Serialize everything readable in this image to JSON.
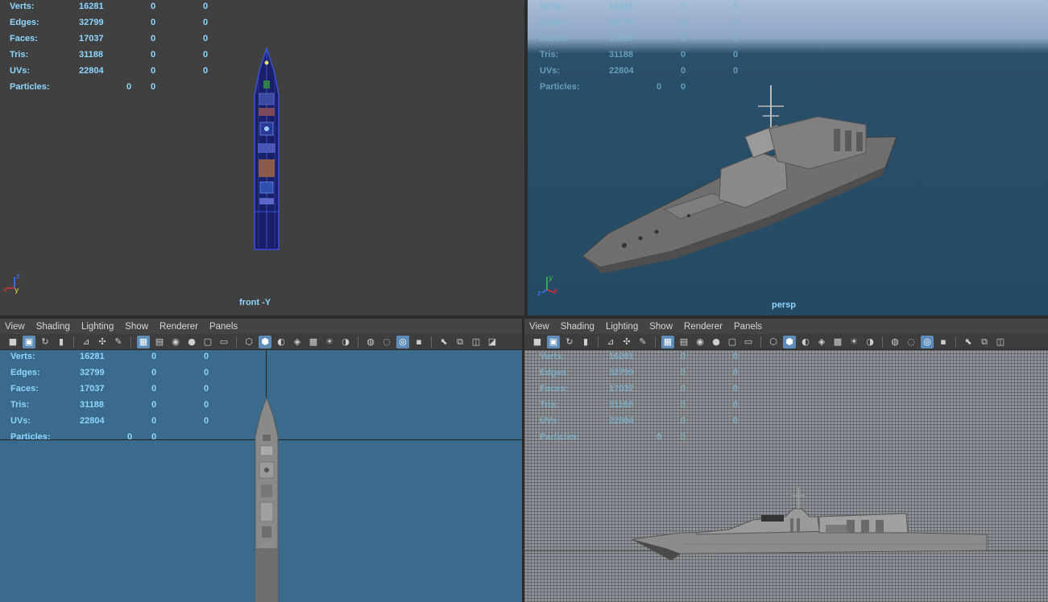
{
  "stats": [
    {
      "label": "Verts:",
      "v1": "16281",
      "v2": "0",
      "v3": "0"
    },
    {
      "label": "Edges:",
      "v1": "32799",
      "v2": "0",
      "v3": "0"
    },
    {
      "label": "Faces:",
      "v1": "17037",
      "v2": "0",
      "v3": "0"
    },
    {
      "label": "Tris:",
      "v1": "31188",
      "v2": "0",
      "v3": "0"
    },
    {
      "label": "UVs:",
      "v1": "22804",
      "v2": "0",
      "v3": "0"
    }
  ],
  "particles": {
    "label": "Particles:",
    "p1": "0",
    "p2": "0"
  },
  "panes": {
    "top_left": {
      "camera": "front -Y"
    },
    "top_right": {
      "camera": "persp"
    }
  },
  "menu": {
    "items": [
      "View",
      "Shading",
      "Lighting",
      "Show",
      "Renderer",
      "Panels"
    ]
  },
  "axis": {
    "x": "x",
    "y": "y",
    "z": "z"
  },
  "toolbar_icons": [
    "camera-icon",
    "film-gate-icon",
    "camera-move-icon",
    "bookmark-icon",
    "image-plane-icon",
    "snap-icon",
    "grease-pencil-icon",
    "grid-icon",
    "resolution-gate-icon",
    "field-chart-icon",
    "safe-action-icon",
    "safe-title-icon",
    "gate-mask-icon",
    "wireframe-icon",
    "smooth-shade-icon",
    "default-material-icon",
    "textured-icon",
    "shadows-icon",
    "lights-icon",
    "ao-icon",
    "motion-blur-icon",
    "antialias-icon",
    "isolate-icon",
    "xray-icon",
    "xray-joints-icon",
    "xray-components-icon",
    "select-icon",
    "layout-icon",
    "pane-icon",
    "display-icon"
  ],
  "colors": {
    "hud": "#8ed6ff",
    "active": "#5d8cb8"
  }
}
